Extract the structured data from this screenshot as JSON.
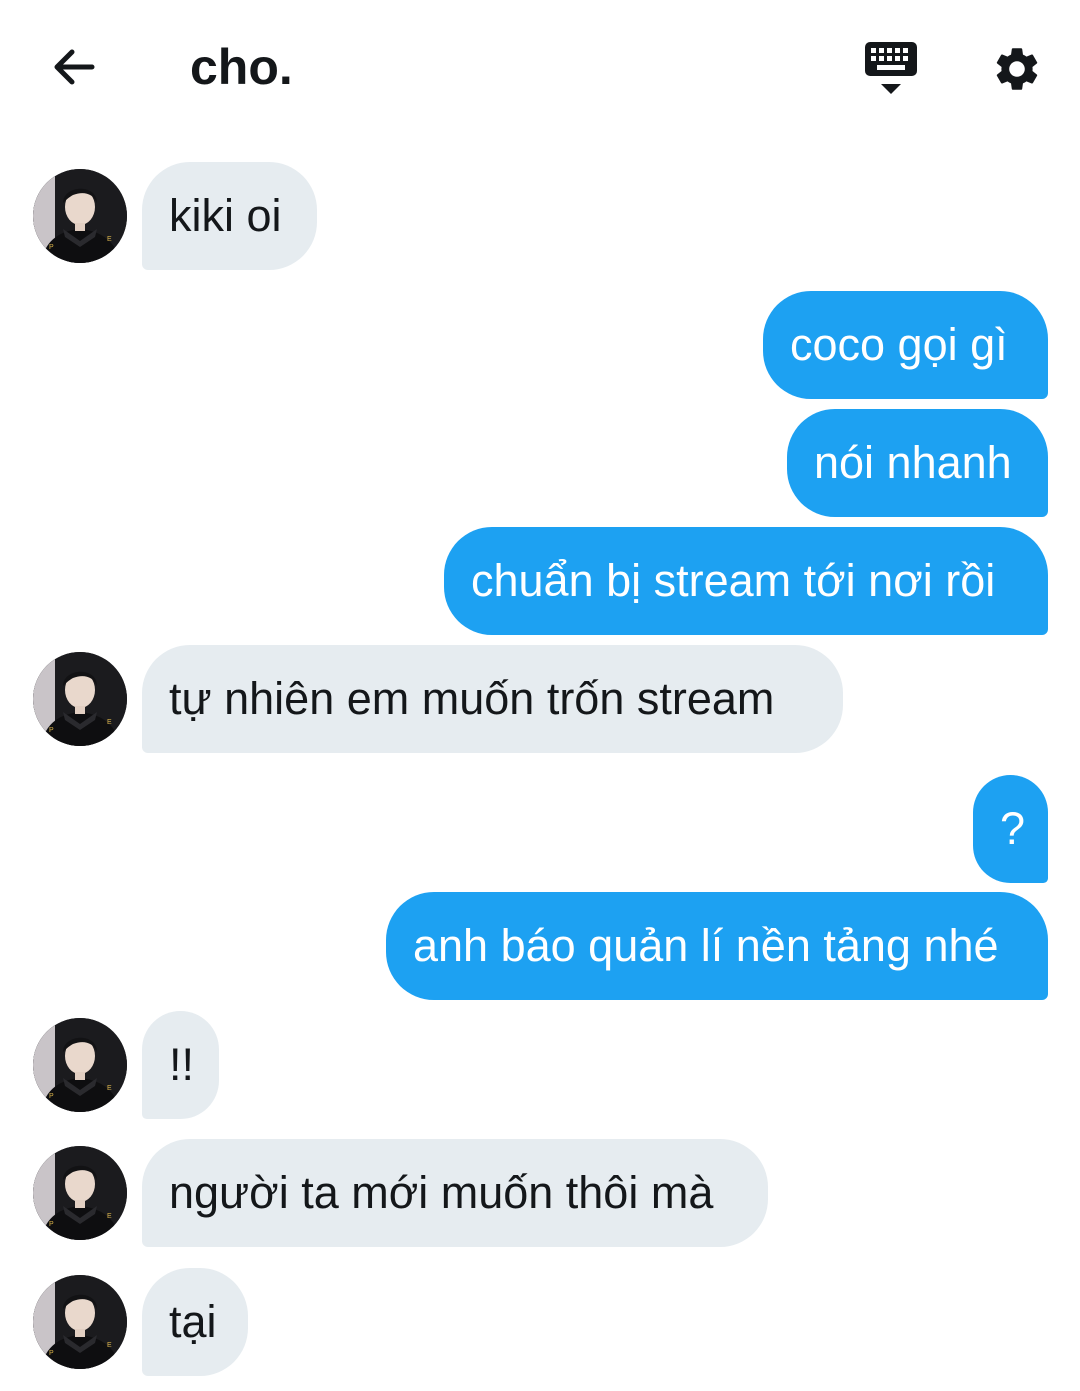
{
  "header": {
    "title": "cho.",
    "back_icon": "arrow-left-icon",
    "keyboard_icon": "keyboard-icon",
    "settings_icon": "gear-icon"
  },
  "messages": [
    {
      "sender": "them",
      "text": "kiki oi"
    },
    {
      "sender": "me",
      "text": "coco gọi gì"
    },
    {
      "sender": "me",
      "text": "nói nhanh"
    },
    {
      "sender": "me",
      "text": "chuẩn bị stream tới nơi rồi"
    },
    {
      "sender": "them",
      "text": "tự nhiên em muốn trốn stream"
    },
    {
      "sender": "me",
      "text": "?"
    },
    {
      "sender": "me",
      "text": "anh báo quản lí nền tảng nhé"
    },
    {
      "sender": "them",
      "text": "!!"
    },
    {
      "sender": "them",
      "text": "người ta mới muốn thôi mà"
    },
    {
      "sender": "them",
      "text": "tại"
    }
  ],
  "colors": {
    "outgoing_bubble": "#1da1f2",
    "incoming_bubble": "#e6ecf0",
    "text_dark": "#14171a"
  }
}
